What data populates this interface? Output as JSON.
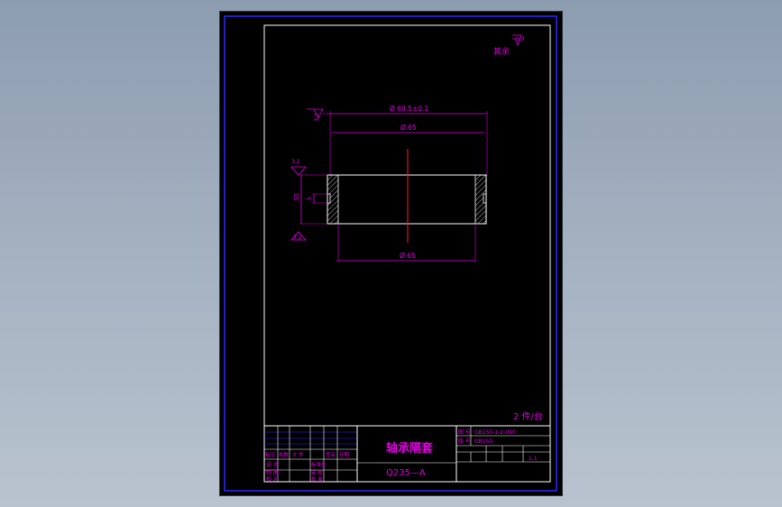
{
  "drawing": {
    "surface_finish_note_label": "其余",
    "surface_finish_note_value": "6.3",
    "dim_outer_diameter": "Ø 69.5±0.1",
    "dim_inner_top": "Ø 65",
    "dim_inner_bottom": "Ø 65",
    "dim_height": "30",
    "dim_groove": "5",
    "roughness_left_top": "3.2",
    "roughness_left_mid": "3.2",
    "roughness_left_bottom": "3.2"
  },
  "title_block": {
    "quantity": "2 件/台",
    "part_name": "轴承隔套",
    "material": "Q235—A",
    "label_drawing_no": "图 号",
    "drawing_no_value": "GB150-1-2-090",
    "label_scale_no": "版 号",
    "scale_no_value": "GB150",
    "ratio": "1:1",
    "rows_left": [
      [
        "标记",
        "处数",
        "文 件",
        "签名",
        "日期"
      ],
      [
        "设 计",
        "",
        "标准化",
        "",
        ""
      ],
      [
        "制 图",
        "",
        "审 核",
        "",
        ""
      ],
      [
        "校 对",
        "",
        "批 准",
        "",
        ""
      ]
    ]
  },
  "colors": {
    "frame_blue": "#2a2aff",
    "white_line": "#ffffff",
    "magenta": "#e000e0",
    "centerline_red": "#ff2020",
    "background": "#000000"
  }
}
